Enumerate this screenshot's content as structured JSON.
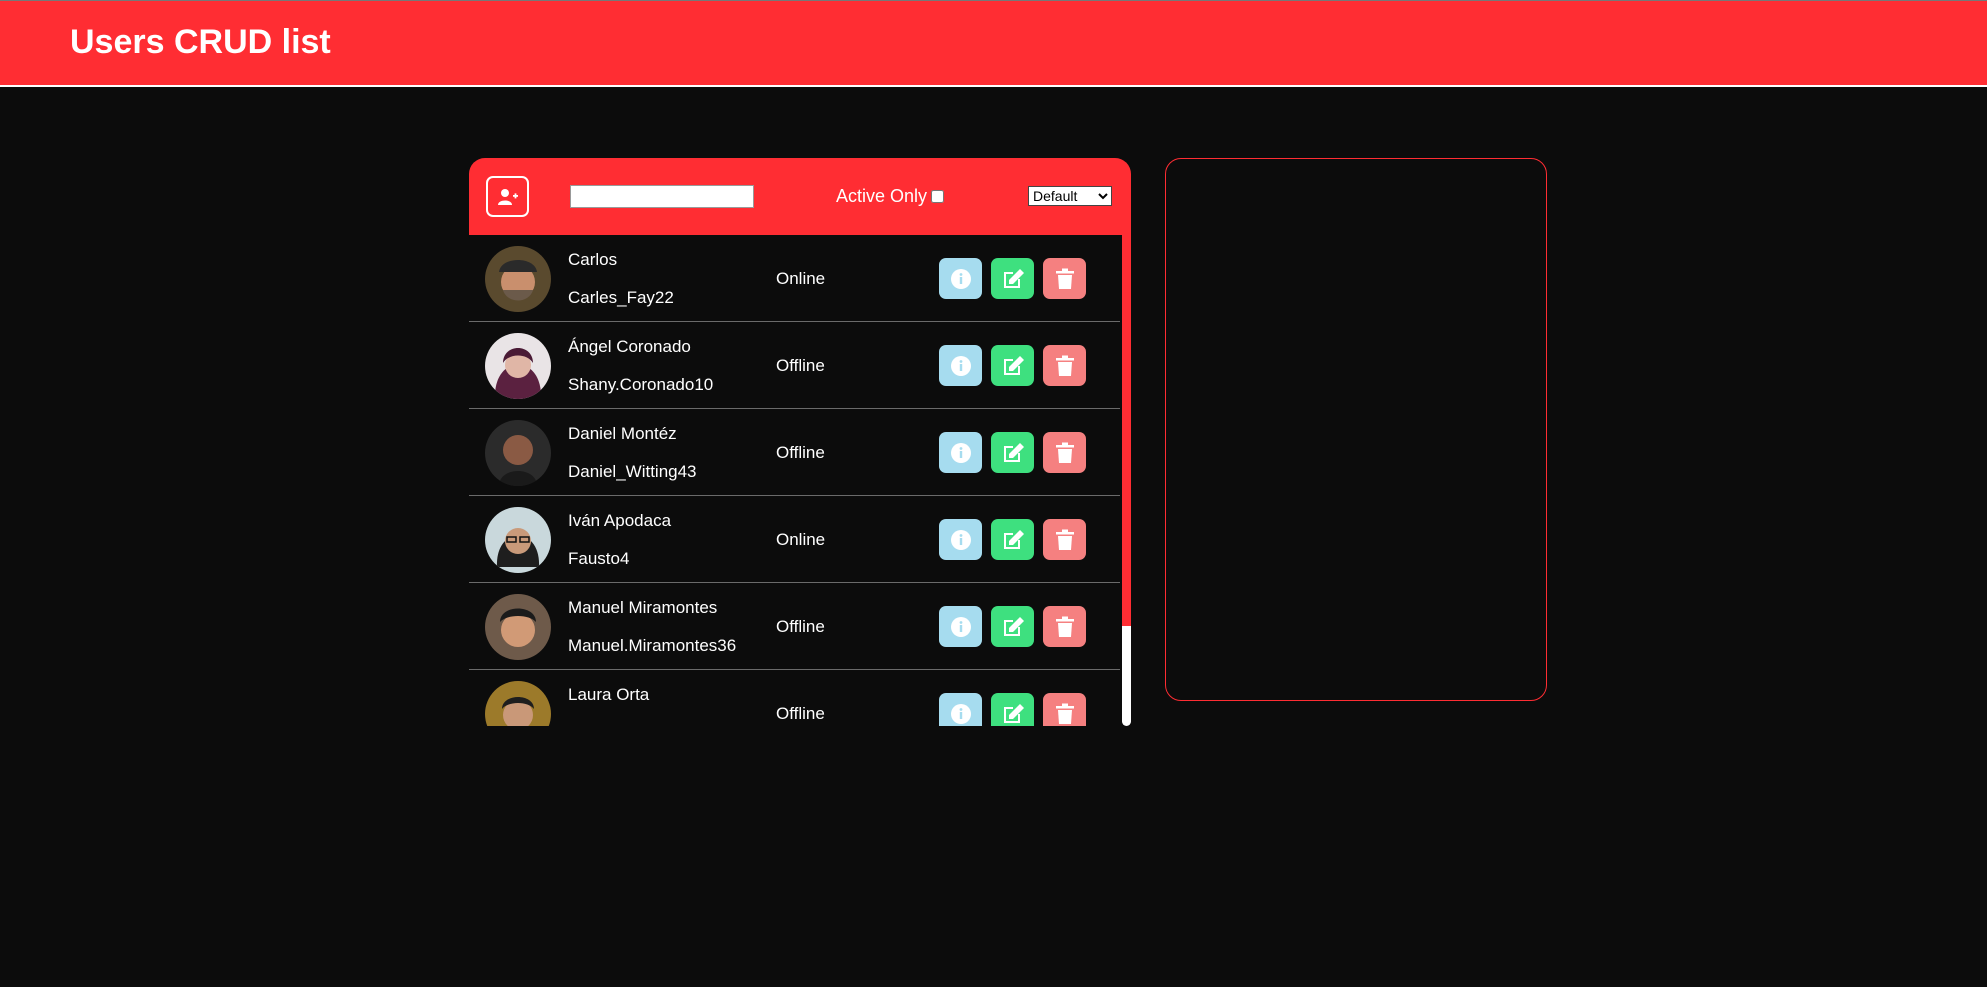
{
  "header": {
    "title": "Users CRUD list"
  },
  "toolbar": {
    "add_user_icon": "user-plus-icon",
    "search": {
      "value": "",
      "placeholder": ""
    },
    "active_only_label": "Active Only",
    "active_only_checked": false,
    "sort": {
      "selected": "Default",
      "options": [
        "Default"
      ]
    }
  },
  "colors": {
    "accent": "#ff2d33",
    "background": "#0c0c0c",
    "info": "#a6dcef",
    "edit": "#3ee07f",
    "delete": "#f58080"
  },
  "users": [
    {
      "name": "Carlos",
      "handle": "Carles_Fay22",
      "status": "Online"
    },
    {
      "name": "Ángel Coronado",
      "handle": "Shany.Coronado10",
      "status": "Offline"
    },
    {
      "name": "Daniel Montéz",
      "handle": "Daniel_Witting43",
      "status": "Offline"
    },
    {
      "name": "Iván Apodaca",
      "handle": "Fausto4",
      "status": "Online"
    },
    {
      "name": "Manuel Miramontes",
      "handle": "Manuel.Miramontes36",
      "status": "Offline"
    },
    {
      "name": "Laura Orta",
      "handle": "",
      "status": "Offline"
    }
  ],
  "row_actions": {
    "info_icon": "info-icon",
    "edit_icon": "edit-icon",
    "delete_icon": "trash-icon"
  }
}
